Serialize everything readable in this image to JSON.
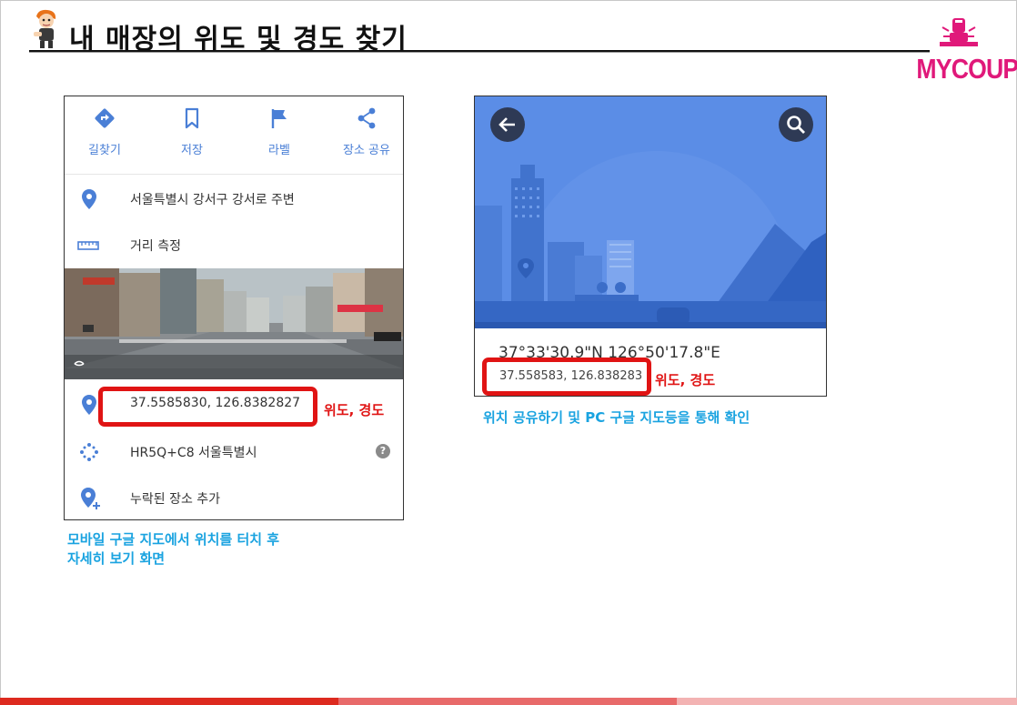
{
  "header": {
    "title": "내 매장의 위도 및 경도 찾기",
    "logo_text": "MYCOUP"
  },
  "left_panel": {
    "actions": [
      {
        "label": "길찾기",
        "icon": "directions-icon"
      },
      {
        "label": "저장",
        "icon": "bookmark-icon"
      },
      {
        "label": "라벨",
        "icon": "flag-icon"
      },
      {
        "label": "장소 공유",
        "icon": "share-icon"
      }
    ],
    "address": "서울특별시 강서구 강서로 주변",
    "measure": "거리 측정",
    "coordinates": "37.5585830, 126.8382827",
    "plus_code": "HR5Q+C8 서울특별시",
    "add_place": "누락된 장소 추가",
    "help_icon": "?"
  },
  "right_panel": {
    "dms": "37°33'30.9\"N 126°50'17.8\"E",
    "decimal": "37.558583, 126.838283"
  },
  "labels": {
    "lat_lng_left": "위도, 경도",
    "lat_lng_right": "위도, 경도"
  },
  "captions": {
    "left_line1": "모바일 구글 지도에서 위치를 터치 후",
    "left_line2": "자세히 보기 화면",
    "right": "위치 공유하기 및 PC 구글 지도등을 통해 확인"
  },
  "colors": {
    "accent_blue": "#4a7fd6",
    "highlight_red": "#e01414",
    "caption_blue": "#1aa3e0",
    "brand_pink": "#e0197a",
    "map_blue": "#5b8de6"
  }
}
